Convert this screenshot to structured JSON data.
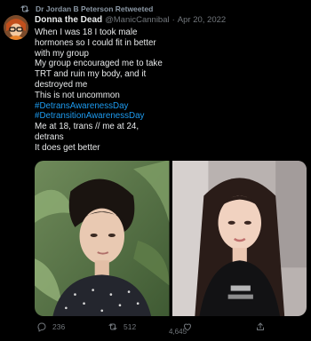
{
  "retweet_banner": {
    "text": "Dr Jordan B Peterson Retweeted",
    "icon": "retweet-icon"
  },
  "tweet": {
    "display_name": "Donna the Dead",
    "handle": "@ManicCannibal",
    "separator": "·",
    "date": "Apr 20, 2022",
    "lines": [
      "When I was 18 I took male",
      "hormones so I could fit in better",
      "with my group",
      "My group encouraged me to take",
      "TRT and ruin my body, and it",
      "destroyed me",
      "This is not uncommon"
    ],
    "hashtags": [
      "#DetransAwarenessDay",
      "#DetransitionAwarenessDay"
    ],
    "closing_lines": [
      "Me at 18, trans // me at 24,",
      "detrans",
      "It does get better"
    ]
  },
  "metrics": {
    "replies": "236",
    "retweets": "512",
    "likes": "4,645"
  },
  "colors": {
    "background": "#000000",
    "text": "#e7e9ea",
    "muted": "#71767b",
    "link": "#1d9bf0"
  }
}
